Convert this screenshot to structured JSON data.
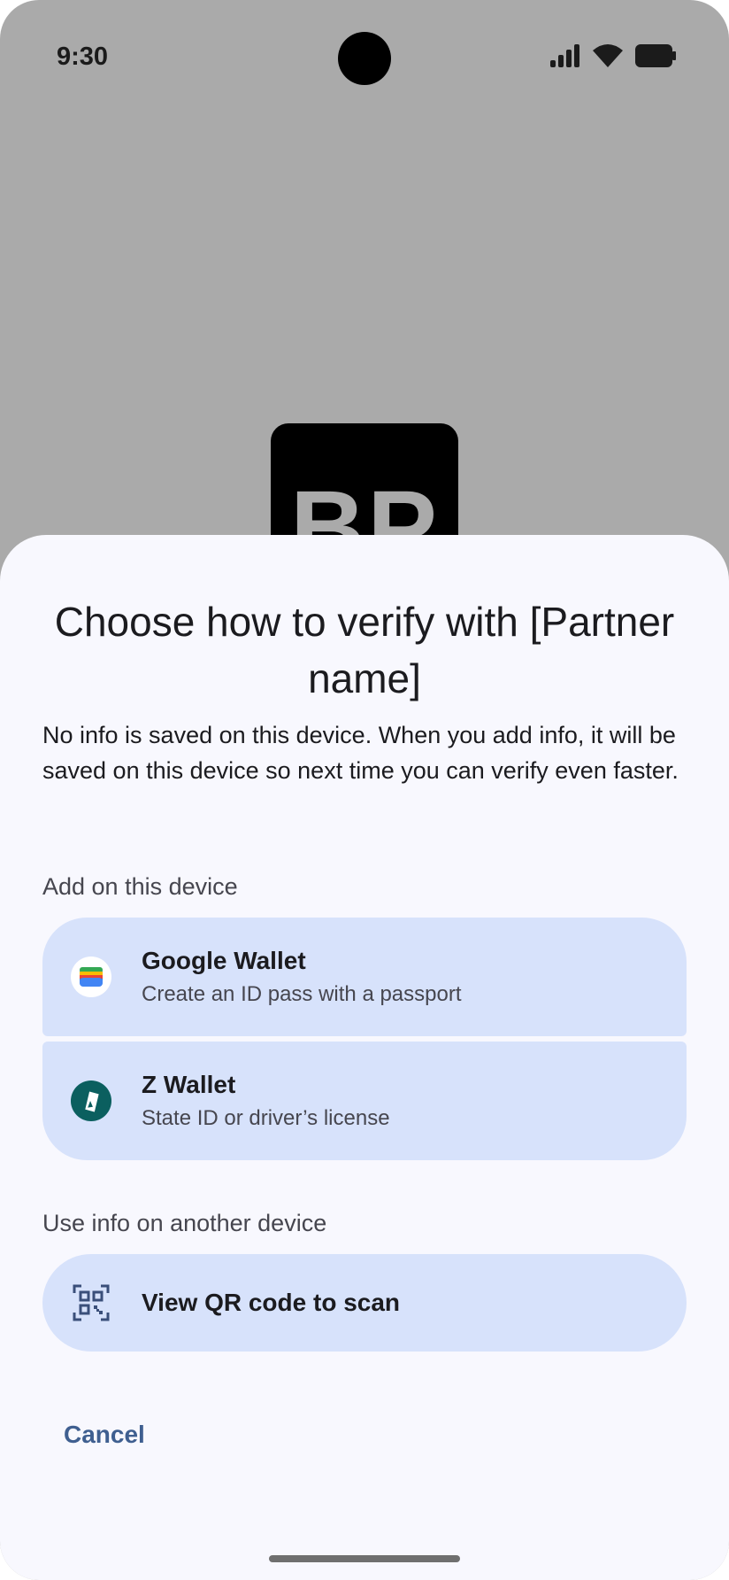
{
  "status_bar": {
    "time": "9:30"
  },
  "logo": {
    "text": "BP"
  },
  "sheet": {
    "title": "Choose how to verify with [Partner name]",
    "description": "No info is saved on this device. When you add info, it will be saved on this device so next time you can verify even faster.",
    "add_section_label": "Add on this device",
    "options": [
      {
        "title": "Google Wallet",
        "subtitle": "Create an ID pass with a passport",
        "icon": "google-wallet-icon"
      },
      {
        "title": "Z Wallet",
        "subtitle": "State ID or driver’s license",
        "icon": "z-wallet-icon"
      }
    ],
    "other_section_label": "Use info on another device",
    "qr_option": {
      "title": "View QR code to scan",
      "icon": "qr-code-icon"
    },
    "cancel_label": "Cancel"
  },
  "colors": {
    "sheet_background": "#f8f8fe",
    "card_background": "#d7e2fb",
    "accent": "#3f5f90",
    "scrim": "#aaaaaa"
  }
}
